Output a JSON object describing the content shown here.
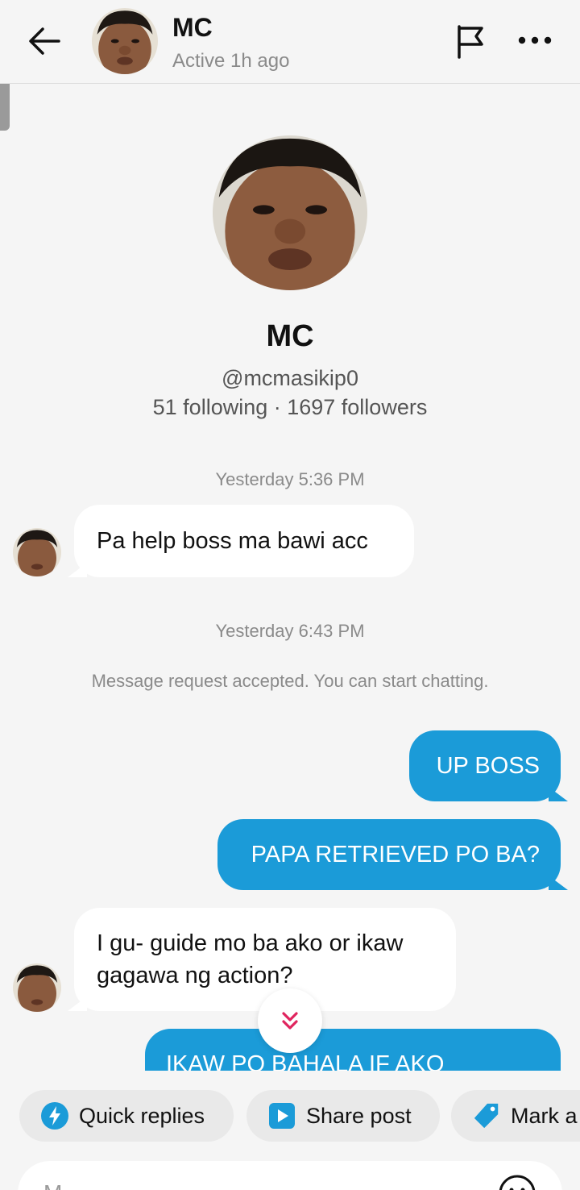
{
  "header": {
    "name": "MC",
    "status": "Active 1h ago"
  },
  "profile": {
    "name": "MC",
    "handle": "@mcmasikip0",
    "stats": "51 following · 1697 followers"
  },
  "messages": {
    "ts1": "Yesterday 5:36 PM",
    "m1": "Pa help boss ma bawi acc",
    "ts2": "Yesterday 6:43 PM",
    "system": "Message request accepted. You can start chatting.",
    "m2": "UP BOSS",
    "m3": "PAPA RETRIEVED PO BA?",
    "m4_line1": "I gu- guide mo ba ako or ikaw",
    "m4_line2": "gagawa ng action?",
    "m5_partial": "IKAW PO BAHALA IF AKO"
  },
  "chips": {
    "quick_replies": "Quick replies",
    "share_post": "Share post",
    "mark": "Mark a"
  },
  "input": {
    "placeholder": "M"
  },
  "colors": {
    "accent": "#1b9bd8",
    "scroll_arrow": "#e0245e",
    "quick_icon": "#1b9bd8",
    "background": "#f5f5f5"
  },
  "icons": [
    "back-arrow-icon",
    "flag-icon",
    "more-icon",
    "chevron-double-down-icon",
    "lightning-icon",
    "play-icon",
    "tag-icon",
    "emoji-icon"
  ]
}
